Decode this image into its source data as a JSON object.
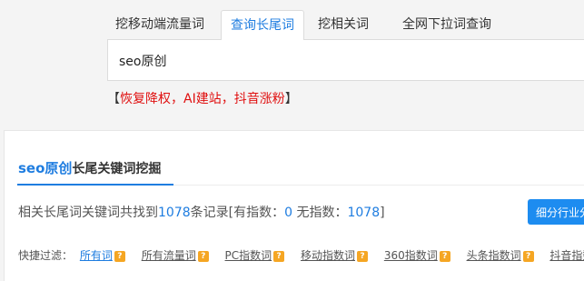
{
  "tabs": [
    {
      "label": "挖移动端流量词"
    },
    {
      "label": "查询长尾词"
    },
    {
      "label": "挖相关词"
    },
    {
      "label": "全网下拉词查询"
    }
  ],
  "search": {
    "value": "seo原创"
  },
  "promo": {
    "open": "【",
    "text": "恢复降权，AI建站，抖音涨粉",
    "close": "】"
  },
  "panel": {
    "title_keyword": "seo原创",
    "title_suffix": "长尾关键词挖掘",
    "summary": {
      "prefix": "相关长尾词关键词共找到",
      "total": "1078",
      "mid": "条记录[有指数：",
      "with_index": "0",
      "mid2": "  无指数：",
      "without_index": "1078",
      "suffix": "]"
    },
    "industry_button": "细分行业分析",
    "filter_label": "快捷过滤：",
    "filters": [
      {
        "label": "所有词",
        "active": true
      },
      {
        "label": "所有流量词"
      },
      {
        "label": "PC指数词"
      },
      {
        "label": "移动指数词"
      },
      {
        "label": "360指数词"
      },
      {
        "label": "头条指数词"
      },
      {
        "label": "抖音指数词"
      }
    ],
    "help_icon": "?"
  },
  "colors": {
    "accent": "#1f7de0",
    "promo": "#e01010",
    "button": "#1d8cf0",
    "help_icon_bg": "#f5a623"
  }
}
